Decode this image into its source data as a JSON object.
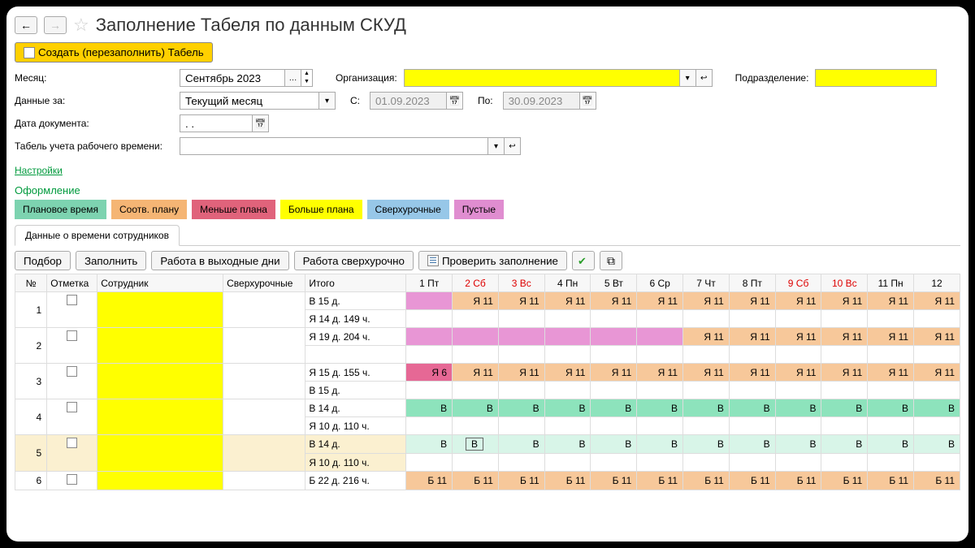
{
  "title": "Заполнение Табеля по данным СКУД",
  "create_button": "Создать (перезаполнить) Табель",
  "labels": {
    "month": "Месяц:",
    "data_for": "Данные за:",
    "doc_date": "Дата документа:",
    "timesheet": "Табель учета рабочего времени:",
    "org": "Организация:",
    "subdiv": "Подразделение:",
    "from": "С:",
    "to": "По:"
  },
  "fields": {
    "month": "Сентябрь 2023",
    "data_for": "Текущий месяц",
    "doc_date": ". .",
    "from": "01.09.2023",
    "to": "30.09.2023",
    "timesheet": ""
  },
  "settings_link": "Настройки",
  "design_title": "Оформление",
  "legend": [
    {
      "label": "Плановое время",
      "class": "c-plan"
    },
    {
      "label": "Соотв. плану",
      "class": "c-match"
    },
    {
      "label": "Меньше плана",
      "class": "c-less"
    },
    {
      "label": "Больше плана",
      "class": "c-more"
    },
    {
      "label": "Сверхурочные",
      "class": "c-over"
    },
    {
      "label": "Пустые",
      "class": "c-empty"
    }
  ],
  "tab": "Данные о времени сотрудников",
  "toolbar": {
    "select": "Подбор",
    "fill": "Заполнить",
    "weekends": "Работа в выходные дни",
    "overtime": "Работа сверхурочно",
    "check": "Проверить заполнение"
  },
  "columns": {
    "num": "№",
    "mark": "Отметка",
    "employee": "Сотрудник",
    "overtime": "Сверхурочные",
    "total": "Итого",
    "days": [
      {
        "label": "1 Пт",
        "wk": false
      },
      {
        "label": "2 Сб",
        "wk": true
      },
      {
        "label": "3 Вс",
        "wk": true
      },
      {
        "label": "4 Пн",
        "wk": false
      },
      {
        "label": "5 Вт",
        "wk": false
      },
      {
        "label": "6 Ср",
        "wk": false
      },
      {
        "label": "7 Чт",
        "wk": false
      },
      {
        "label": "8 Пт",
        "wk": false
      },
      {
        "label": "9 Сб",
        "wk": true
      },
      {
        "label": "10 Вс",
        "wk": true
      },
      {
        "label": "11 Пн",
        "wk": false
      },
      {
        "label": "12",
        "wk": false
      }
    ]
  },
  "rows": [
    {
      "num": "1",
      "mark": true,
      "totals": [
        "В 15 д.",
        "Я 14 д. 149 ч."
      ],
      "cells": [
        [
          {
            "v": "",
            "c": "c-magenta"
          },
          {
            "v": "Я 11",
            "c": "c-peach"
          },
          {
            "v": "Я 11",
            "c": "c-peach"
          },
          {
            "v": "Я 11",
            "c": "c-peach"
          },
          {
            "v": "Я 11",
            "c": "c-peach"
          },
          {
            "v": "Я 11",
            "c": "c-peach"
          },
          {
            "v": "Я 11",
            "c": "c-peach"
          },
          {
            "v": "Я 11",
            "c": "c-peach"
          },
          {
            "v": "Я 11",
            "c": "c-peach"
          },
          {
            "v": "Я 11",
            "c": "c-peach"
          },
          {
            "v": "Я 11",
            "c": "c-peach"
          },
          {
            "v": "Я 11",
            "c": "c-peach"
          }
        ],
        [
          {
            "v": ""
          },
          {
            "v": ""
          },
          {
            "v": ""
          },
          {
            "v": ""
          },
          {
            "v": ""
          },
          {
            "v": ""
          },
          {
            "v": ""
          },
          {
            "v": ""
          },
          {
            "v": ""
          },
          {
            "v": ""
          },
          {
            "v": ""
          },
          {
            "v": ""
          }
        ]
      ]
    },
    {
      "num": "2",
      "mark": true,
      "totals": [
        "Я 19 д. 204 ч.",
        ""
      ],
      "cells": [
        [
          {
            "v": "",
            "c": "c-magenta"
          },
          {
            "v": "",
            "c": "c-magenta"
          },
          {
            "v": "",
            "c": "c-magenta"
          },
          {
            "v": "",
            "c": "c-magenta"
          },
          {
            "v": "",
            "c": "c-magenta"
          },
          {
            "v": "",
            "c": "c-magenta"
          },
          {
            "v": "Я 11",
            "c": "c-peach"
          },
          {
            "v": "Я 11",
            "c": "c-peach"
          },
          {
            "v": "Я 11",
            "c": "c-peach"
          },
          {
            "v": "Я 11",
            "c": "c-peach"
          },
          {
            "v": "Я 11",
            "c": "c-peach"
          },
          {
            "v": "Я 11",
            "c": "c-peach"
          }
        ],
        [
          {
            "v": ""
          },
          {
            "v": ""
          },
          {
            "v": ""
          },
          {
            "v": ""
          },
          {
            "v": ""
          },
          {
            "v": ""
          },
          {
            "v": ""
          },
          {
            "v": ""
          },
          {
            "v": ""
          },
          {
            "v": ""
          },
          {
            "v": ""
          },
          {
            "v": ""
          }
        ]
      ]
    },
    {
      "num": "3",
      "mark": true,
      "totals": [
        "Я 15 д. 155 ч.",
        "В 15 д."
      ],
      "cells": [
        [
          {
            "v": "Я 6",
            "c": "c-pink"
          },
          {
            "v": "Я 11",
            "c": "c-peach"
          },
          {
            "v": "Я 11",
            "c": "c-peach"
          },
          {
            "v": "Я 11",
            "c": "c-peach"
          },
          {
            "v": "Я 11",
            "c": "c-peach"
          },
          {
            "v": "Я 11",
            "c": "c-peach"
          },
          {
            "v": "Я 11",
            "c": "c-peach"
          },
          {
            "v": "Я 11",
            "c": "c-peach"
          },
          {
            "v": "Я 11",
            "c": "c-peach"
          },
          {
            "v": "Я 11",
            "c": "c-peach"
          },
          {
            "v": "Я 11",
            "c": "c-peach"
          },
          {
            "v": "Я 11",
            "c": "c-peach"
          }
        ],
        [
          {
            "v": ""
          },
          {
            "v": ""
          },
          {
            "v": ""
          },
          {
            "v": ""
          },
          {
            "v": ""
          },
          {
            "v": ""
          },
          {
            "v": ""
          },
          {
            "v": ""
          },
          {
            "v": ""
          },
          {
            "v": ""
          },
          {
            "v": ""
          },
          {
            "v": ""
          }
        ]
      ]
    },
    {
      "num": "4",
      "mark": true,
      "totals": [
        "В 14 д.",
        "Я 10 д. 110 ч."
      ],
      "cells": [
        [
          {
            "v": "В",
            "c": "c-mint"
          },
          {
            "v": "В",
            "c": "c-mint"
          },
          {
            "v": "В",
            "c": "c-mint"
          },
          {
            "v": "В",
            "c": "c-mint"
          },
          {
            "v": "В",
            "c": "c-mint"
          },
          {
            "v": "В",
            "c": "c-mint"
          },
          {
            "v": "В",
            "c": "c-mint"
          },
          {
            "v": "В",
            "c": "c-mint"
          },
          {
            "v": "В",
            "c": "c-mint"
          },
          {
            "v": "В",
            "c": "c-mint"
          },
          {
            "v": "В",
            "c": "c-mint"
          },
          {
            "v": "В",
            "c": "c-mint"
          }
        ],
        [
          {
            "v": ""
          },
          {
            "v": ""
          },
          {
            "v": ""
          },
          {
            "v": ""
          },
          {
            "v": ""
          },
          {
            "v": ""
          },
          {
            "v": ""
          },
          {
            "v": ""
          },
          {
            "v": ""
          },
          {
            "v": ""
          },
          {
            "v": ""
          },
          {
            "v": ""
          }
        ]
      ]
    },
    {
      "num": "5",
      "mark": true,
      "rowclass": "c-cream",
      "totals": [
        "В 14 д.",
        "Я 10 д. 110 ч."
      ],
      "cells": [
        [
          {
            "v": "В",
            "c": "c-mintlt"
          },
          {
            "v": "В",
            "c": "c-mintlt",
            "boxed": true
          },
          {
            "v": "В",
            "c": "c-mintlt"
          },
          {
            "v": "В",
            "c": "c-mintlt"
          },
          {
            "v": "В",
            "c": "c-mintlt"
          },
          {
            "v": "В",
            "c": "c-mintlt"
          },
          {
            "v": "В",
            "c": "c-mintlt"
          },
          {
            "v": "В",
            "c": "c-mintlt"
          },
          {
            "v": "В",
            "c": "c-mintlt"
          },
          {
            "v": "В",
            "c": "c-mintlt"
          },
          {
            "v": "В",
            "c": "c-mintlt"
          },
          {
            "v": "В",
            "c": "c-mintlt"
          }
        ],
        [
          {
            "v": ""
          },
          {
            "v": ""
          },
          {
            "v": ""
          },
          {
            "v": ""
          },
          {
            "v": ""
          },
          {
            "v": ""
          },
          {
            "v": ""
          },
          {
            "v": ""
          },
          {
            "v": ""
          },
          {
            "v": ""
          },
          {
            "v": ""
          },
          {
            "v": ""
          }
        ]
      ]
    },
    {
      "num": "6",
      "mark": true,
      "totals": [
        "Б 22 д. 216 ч."
      ],
      "cells": [
        [
          {
            "v": "Б 11",
            "c": "c-peach"
          },
          {
            "v": "Б 11",
            "c": "c-peach"
          },
          {
            "v": "Б 11",
            "c": "c-peach"
          },
          {
            "v": "Б 11",
            "c": "c-peach"
          },
          {
            "v": "Б 11",
            "c": "c-peach"
          },
          {
            "v": "Б 11",
            "c": "c-peach"
          },
          {
            "v": "Б 11",
            "c": "c-peach"
          },
          {
            "v": "Б 11",
            "c": "c-peach"
          },
          {
            "v": "Б 11",
            "c": "c-peach"
          },
          {
            "v": "Б 11",
            "c": "c-peach"
          },
          {
            "v": "Б 11",
            "c": "c-peach"
          },
          {
            "v": "Б 11",
            "c": "c-peach"
          }
        ]
      ]
    }
  ]
}
